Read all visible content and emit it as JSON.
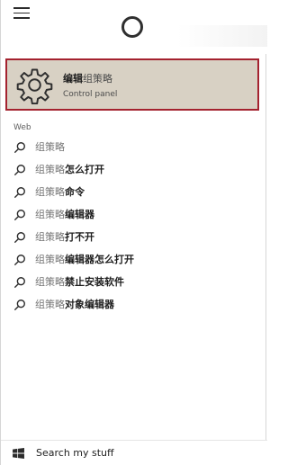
{
  "top": {
    "menu_icon": "hamburger-menu-icon",
    "cortana_icon": "cortana-ring-icon"
  },
  "best_match": {
    "title_prefix": "编辑",
    "title_suffix": "组策略",
    "subtitle": "Control panel",
    "icon": "gear-icon"
  },
  "section": {
    "label": "Web"
  },
  "results": [
    {
      "muted": "组策略",
      "strong": ""
    },
    {
      "muted": "组策略",
      "strong": "怎么打开"
    },
    {
      "muted": "组策略",
      "strong": "命令"
    },
    {
      "muted": "组策略",
      "strong": "编辑器"
    },
    {
      "muted": "组策略",
      "strong": "打不开"
    },
    {
      "muted": "组策略",
      "strong": "编辑器怎么打开"
    },
    {
      "muted": "组策略",
      "strong": "禁止安装软件"
    },
    {
      "muted": "组策略",
      "strong": "对象编辑器"
    }
  ],
  "footer": {
    "label": "Search my stuff",
    "icon": "windows-logo-icon"
  },
  "colors": {
    "selected_background": "#d8d1c4",
    "selected_border": "#a4222f"
  }
}
